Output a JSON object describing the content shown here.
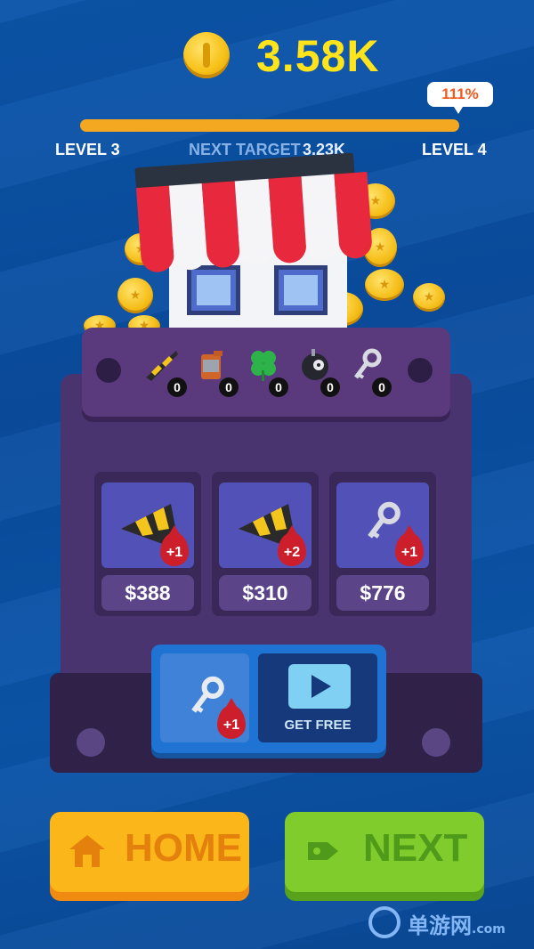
{
  "header": {
    "coins": "3.58K",
    "progress_percent_label": "111%",
    "progress_fill": 1.0,
    "current_level": "LEVEL 3",
    "next_target_label": "NEXT TARGET",
    "next_target_value": "3.23K",
    "next_level": "LEVEL 4"
  },
  "inventory": [
    {
      "icon": "cone-icon",
      "count": "0"
    },
    {
      "icon": "fuel-can-icon",
      "count": "0"
    },
    {
      "icon": "clover-icon",
      "count": "0"
    },
    {
      "icon": "bomb-icon",
      "count": "0"
    },
    {
      "icon": "key-icon",
      "count": "0"
    }
  ],
  "slots": [
    {
      "icon": "cone-icon",
      "bonus": "+1",
      "price": "$388"
    },
    {
      "icon": "cone-icon",
      "bonus": "+2",
      "price": "$310"
    },
    {
      "icon": "key-icon",
      "bonus": "+1",
      "price": "$776"
    }
  ],
  "free_offer": {
    "bonus": "+1",
    "label": "GET FREE"
  },
  "buttons": {
    "home": "HOME",
    "next": "NEXT"
  },
  "watermark": {
    "text": "单游网",
    "domain": ".com"
  },
  "colors": {
    "background": "#0a4fa0",
    "coin_text": "#ffe41c",
    "progress": "#f4a821",
    "machine": "#4a3470",
    "home_button": "#fbb61a",
    "next_button": "#80cc2c"
  }
}
